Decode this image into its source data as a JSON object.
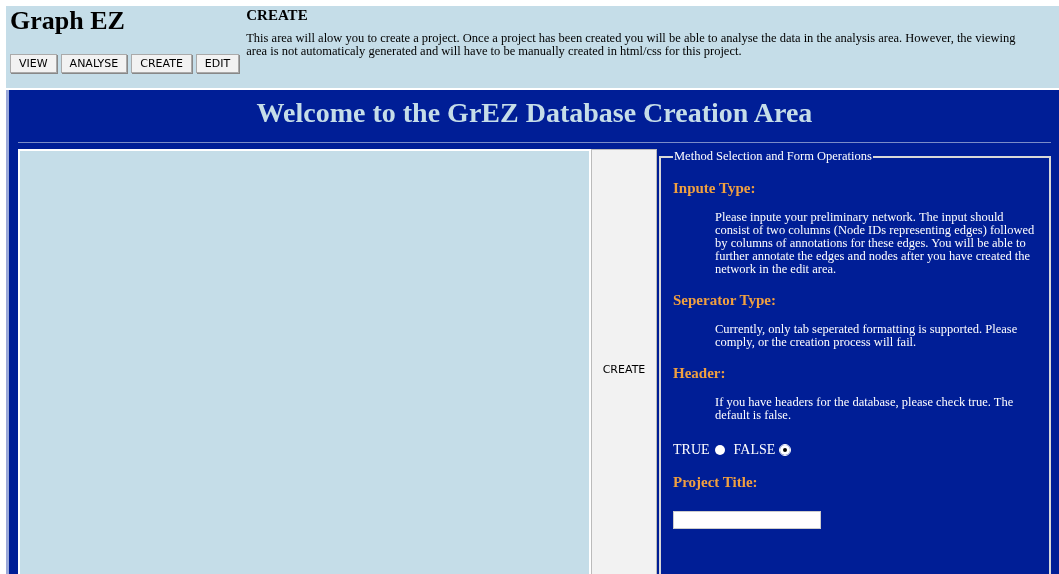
{
  "app_title": "Graph EZ",
  "nav_buttons": [
    {
      "label": "VIEW"
    },
    {
      "label": "ANALYSE"
    },
    {
      "label": "CREATE"
    },
    {
      "label": "EDIT"
    }
  ],
  "info": {
    "heading": "CREATE",
    "text": "This area will alow you to create a project. Once a project has been created you will be able to analyse the data in the analysis area. However, the viewing area is not automaticaly generated and will have to be manually created in html/css for this project."
  },
  "main_title": "Welcome to the GrEZ Database Creation Area",
  "create_button": "CREATE",
  "fieldset": {
    "legend": "Method Selection and Form Operations",
    "sections": [
      {
        "heading": "Inpute Type:",
        "text": "Please inpute your preliminary network. The input should consist of two columns (Node IDs representing edges) followed by columns of annotations for these edges. You will be able to further annotate the edges and nodes after you have created the network in the edit area."
      },
      {
        "heading": "Seperator Type:",
        "text": "Currently, only tab seperated formatting is supported. Please comply, or the creation process will fail."
      },
      {
        "heading": "Header:",
        "text": "If you have headers for the database, please check true. The default is false."
      }
    ],
    "header_options": [
      {
        "label": "TRUE",
        "selected": false
      },
      {
        "label": "FALSE",
        "selected": true
      }
    ],
    "title_heading": "Project Title:"
  }
}
